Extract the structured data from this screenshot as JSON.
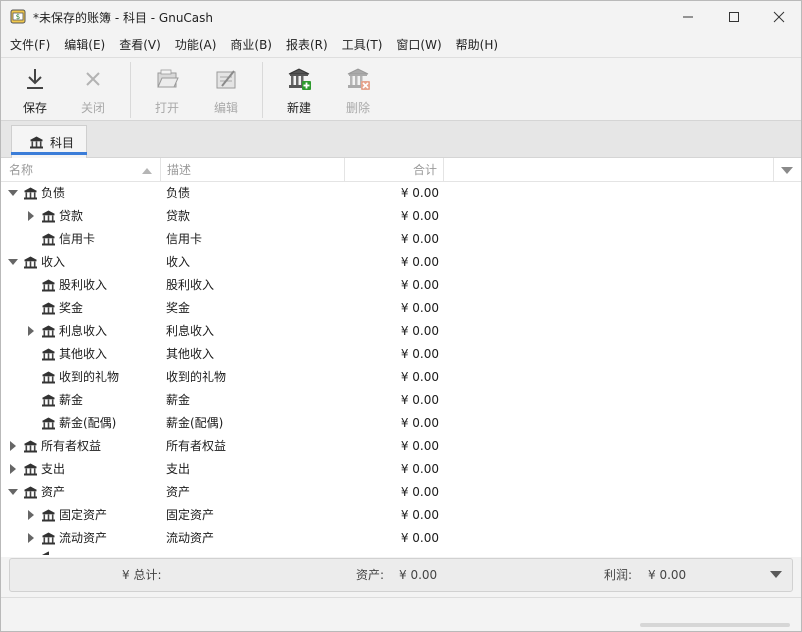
{
  "window": {
    "title": "*未保存的账簿 - 科目 - GnuCash"
  },
  "menubar": {
    "items": [
      {
        "label": "文件(F)"
      },
      {
        "label": "编辑(E)"
      },
      {
        "label": "查看(V)"
      },
      {
        "label": "功能(A)"
      },
      {
        "label": "商业(B)"
      },
      {
        "label": "报表(R)"
      },
      {
        "label": "工具(T)"
      },
      {
        "label": "窗口(W)"
      },
      {
        "label": "帮助(H)"
      }
    ]
  },
  "toolbar": {
    "save_label": "保存",
    "close_label": "关闭",
    "open_label": "打开",
    "edit_label": "编辑",
    "new_label": "新建",
    "delete_label": "删除"
  },
  "tabs": [
    {
      "label": "科目"
    }
  ],
  "tree": {
    "columns": {
      "name": "名称",
      "description": "描述",
      "total": "合计"
    },
    "rows": [
      {
        "name": "负债",
        "description": "负债",
        "total": "¥ 0.00",
        "level": 0,
        "expander": "expanded"
      },
      {
        "name": "贷款",
        "description": "贷款",
        "total": "¥ 0.00",
        "level": 1,
        "expander": "collapsed"
      },
      {
        "name": "信用卡",
        "description": "信用卡",
        "total": "¥ 0.00",
        "level": 1,
        "expander": "none"
      },
      {
        "name": "收入",
        "description": "收入",
        "total": "¥ 0.00",
        "level": 0,
        "expander": "expanded"
      },
      {
        "name": "股利收入",
        "description": "股利收入",
        "total": "¥ 0.00",
        "level": 1,
        "expander": "none"
      },
      {
        "name": "奖金",
        "description": "奖金",
        "total": "¥ 0.00",
        "level": 1,
        "expander": "none"
      },
      {
        "name": "利息收入",
        "description": "利息收入",
        "total": "¥ 0.00",
        "level": 1,
        "expander": "collapsed"
      },
      {
        "name": "其他收入",
        "description": "其他收入",
        "total": "¥ 0.00",
        "level": 1,
        "expander": "none"
      },
      {
        "name": "收到的礼物",
        "description": "收到的礼物",
        "total": "¥ 0.00",
        "level": 1,
        "expander": "none"
      },
      {
        "name": "薪金",
        "description": "薪金",
        "total": "¥ 0.00",
        "level": 1,
        "expander": "none"
      },
      {
        "name": "薪金(配偶)",
        "description": "薪金(配偶)",
        "total": "¥ 0.00",
        "level": 1,
        "expander": "none"
      },
      {
        "name": "所有者权益",
        "description": "所有者权益",
        "total": "¥ 0.00",
        "level": 0,
        "expander": "collapsed"
      },
      {
        "name": "支出",
        "description": "支出",
        "total": "¥ 0.00",
        "level": 0,
        "expander": "collapsed"
      },
      {
        "name": "资产",
        "description": "资产",
        "total": "¥ 0.00",
        "level": 0,
        "expander": "expanded"
      },
      {
        "name": "固定资产",
        "description": "固定资产",
        "total": "¥ 0.00",
        "level": 1,
        "expander": "collapsed"
      },
      {
        "name": "流动资产",
        "description": "流动资产",
        "total": "¥ 0.00",
        "level": 1,
        "expander": "collapsed"
      }
    ]
  },
  "summary": {
    "total_label": "¥ 总计:",
    "assets_label": "资产:",
    "assets_value": "¥ 0.00",
    "profit_label": "利润:",
    "profit_value": "¥ 0.00"
  },
  "colors": {
    "accent": "#3b7dd8",
    "icon_dark": "#2b2b2b",
    "new_badge": "#2e9a2e",
    "delete_badge": "#d0603a"
  }
}
